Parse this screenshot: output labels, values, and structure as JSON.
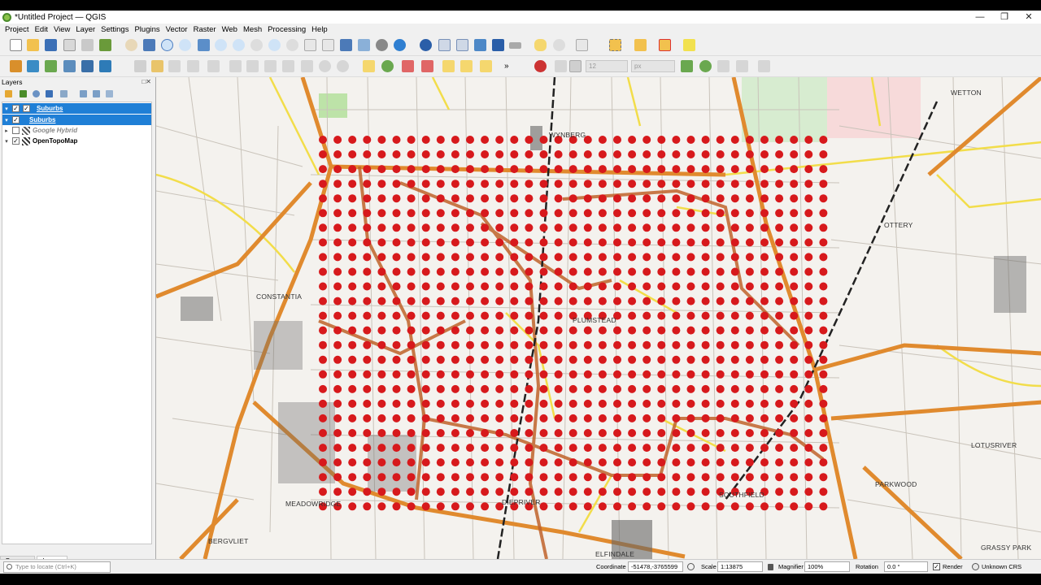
{
  "window": {
    "title": "*Untitled Project — QGIS",
    "controls": [
      "—",
      "❐",
      "✕"
    ]
  },
  "menu": [
    "Project",
    "Edit",
    "View",
    "Layer",
    "Settings",
    "Plugins",
    "Vector",
    "Raster",
    "Web",
    "Mesh",
    "Processing",
    "Help"
  ],
  "toolbar2": {
    "size_value": "12",
    "unit_value": "px"
  },
  "layers_panel": {
    "title": "Layers",
    "close": "□✕",
    "layers": [
      {
        "name": "Suburbs",
        "checked": true,
        "selected": true,
        "style": "u"
      },
      {
        "name": "Suburbs",
        "checked": true,
        "selected": true,
        "style": "u"
      },
      {
        "name": "Google Hybrid",
        "checked": false,
        "selected": false,
        "style": "i"
      },
      {
        "name": "OpenTopoMap",
        "checked": true,
        "selected": false,
        "style": "b"
      }
    ]
  },
  "tabs": {
    "browser": "Browser",
    "layers": "Layers"
  },
  "map": {
    "labels": [
      "WETTON",
      "WYNBERG",
      "OTTERY",
      "CONSTANTIA",
      "PLUMSTEAD",
      "LOTUSRIVER",
      "PARKWOOD",
      "MEADOWRIDGE",
      "DIEPRIVER",
      "SOUTHFIELD",
      "BERGVLIET",
      "GRASSY PARK",
      "ELFINDALE"
    ],
    "point_color": "#d7191c",
    "road_color": "#d9782a"
  },
  "status": {
    "locator_placeholder": "Type to locate (Ctrl+K)",
    "coordinate_label": "Coordinate",
    "coordinate_value": "-51478,-3765599",
    "scale_label": "Scale",
    "scale_value": "1:13875",
    "magnifier_label": "Magnifier",
    "magnifier_value": "100%",
    "rotation_label": "Rotation",
    "rotation_value": "0.0 °",
    "render_label": "Render",
    "crs_label": "Unknown CRS"
  }
}
